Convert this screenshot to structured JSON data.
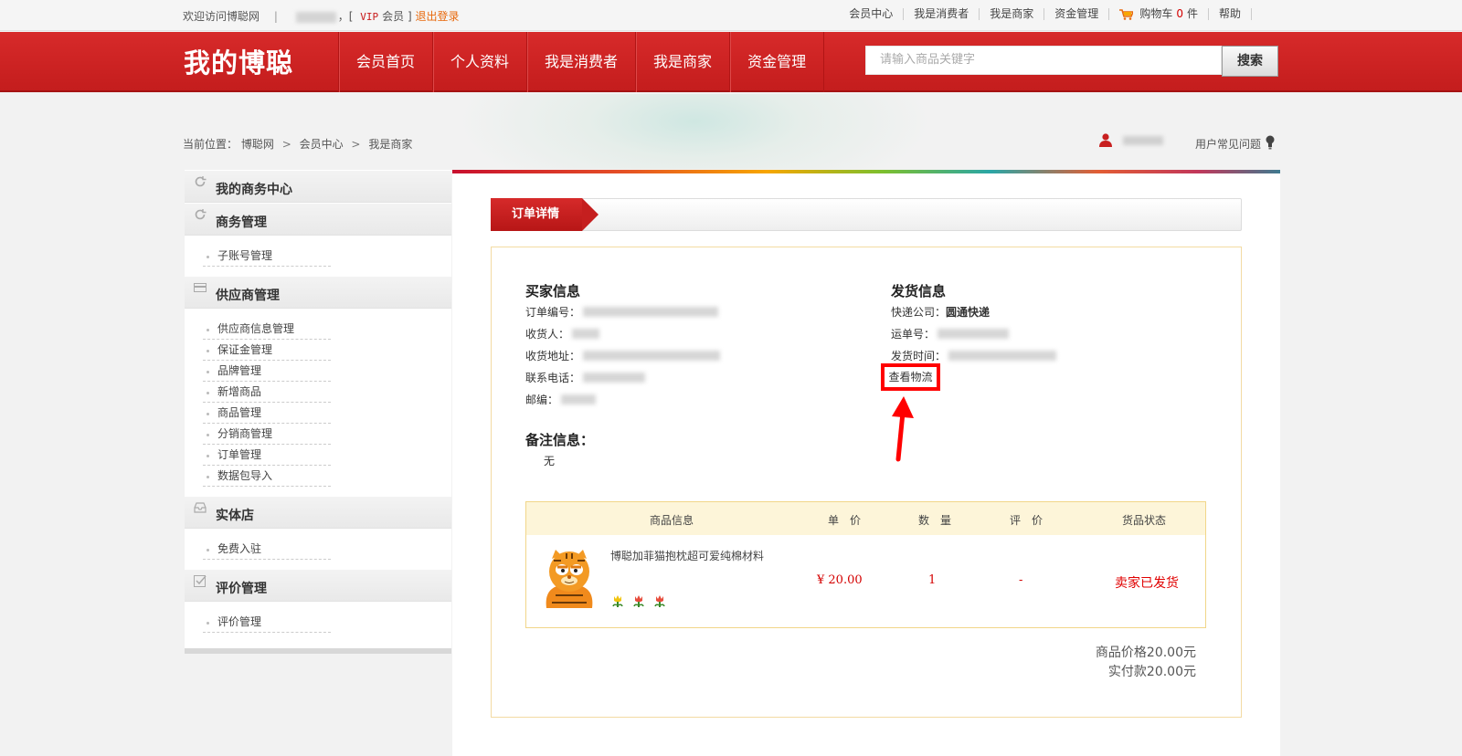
{
  "topbar": {
    "welcome": "欢迎访问博聪网",
    "bracket_open": "，[",
    "vip": "VIP",
    "member": "会员",
    "bracket_close": "]",
    "logout": "退出登录",
    "links": [
      "会员中心",
      "我是消费者",
      "我是商家",
      "资金管理"
    ],
    "cart_label": "购物车",
    "cart_count": "0",
    "cart_unit": "件",
    "help": "帮助"
  },
  "header": {
    "logo": "我的博聪",
    "nav": [
      "会员首页",
      "个人资料",
      "我是消费者",
      "我是商家",
      "资金管理"
    ],
    "search_placeholder": "请输入商品关键字",
    "search_button": "搜索"
  },
  "breadcrumb": {
    "prefix": "当前位置：",
    "items": [
      "博聪网",
      "会员中心",
      "我是商家"
    ],
    "separator": ">"
  },
  "user": {
    "faq": "用户常见问题"
  },
  "sidebar": {
    "sections": [
      {
        "title": "我的商务中心",
        "icon": "refresh-icon",
        "items": []
      },
      {
        "title": "商务管理",
        "icon": "refresh-icon",
        "items": [
          "子账号管理"
        ]
      },
      {
        "title": "供应商管理",
        "icon": "card-icon",
        "items": [
          "供应商信息管理",
          "保证金管理",
          "品牌管理",
          "新增商品",
          "商品管理",
          "分销商管理",
          "订单管理",
          "数据包导入"
        ]
      },
      {
        "title": "实体店",
        "icon": "store-icon",
        "items": [
          "免费入驻"
        ]
      },
      {
        "title": "评价管理",
        "icon": "checkbox-icon",
        "items": [
          "评价管理"
        ]
      }
    ]
  },
  "order": {
    "tab": "订单详情",
    "buyer": {
      "title": "买家信息",
      "order_no_label": "订单编号：",
      "receiver_label": "收货人：",
      "address_label": "收货地址：",
      "phone_label": "联系电话：",
      "zip_label": "邮编："
    },
    "shipping": {
      "title": "发货信息",
      "courier_label": "快递公司：",
      "courier": "圆通快递",
      "waybill_label": "运单号：",
      "ship_time_label": "发货时间：",
      "track_link": "查看物流"
    },
    "remark": {
      "title": "备注信息：",
      "value": "无"
    },
    "table": {
      "headers": [
        "商品信息",
        "单　价",
        "数　量",
        "评　价",
        "货品状态"
      ],
      "row": {
        "name": "博聪加菲猫抱枕超可爱纯棉材料",
        "price": "¥ 20.00",
        "qty": "1",
        "rating": "-",
        "status": "卖家已发货"
      }
    },
    "totals": {
      "goods_price": "商品价格20.00元",
      "paid": "实付款20.00元"
    }
  },
  "colors": {
    "brand_red": "#c81f1f",
    "price_red": "#d40000",
    "highlight": "#ff0000"
  }
}
